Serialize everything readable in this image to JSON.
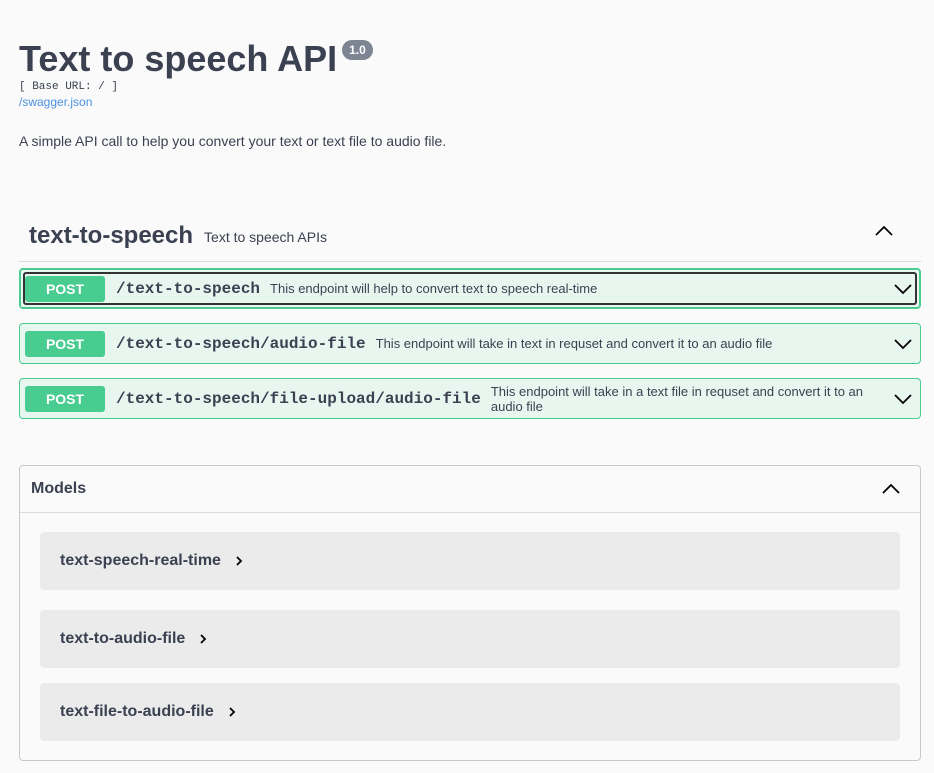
{
  "info": {
    "title": "Text to speech API",
    "version": "1.0",
    "base_url": "[ Base URL: / ]",
    "spec_link": "/swagger.json",
    "description": "A simple API call to help you convert your text or text file to audio file."
  },
  "tag": {
    "name": "text-to-speech",
    "description": "Text to speech APIs",
    "toggle_icon": "chevron-up-icon"
  },
  "operations": [
    {
      "method": "POST",
      "path": "/text-to-speech",
      "summary": "This endpoint will help to convert text to speech real-time"
    },
    {
      "method": "POST",
      "path": "/text-to-speech/audio-file",
      "summary": "This endpoint will take in text in requset and convert it to an audio file"
    },
    {
      "method": "POST",
      "path": "/text-to-speech/file-upload/audio-file",
      "summary": "This endpoint will take in a text file in requset and convert it to an audio file"
    }
  ],
  "models": {
    "title": "Models",
    "items": [
      "text-speech-real-time",
      "text-to-audio-file",
      "text-file-to-audio-file"
    ]
  },
  "colors": {
    "post_accent": "#49cc90",
    "post_bg": "#e8f6f0",
    "version_badge": "#7d8492",
    "link": "#4990e2",
    "text": "#3b4151"
  }
}
